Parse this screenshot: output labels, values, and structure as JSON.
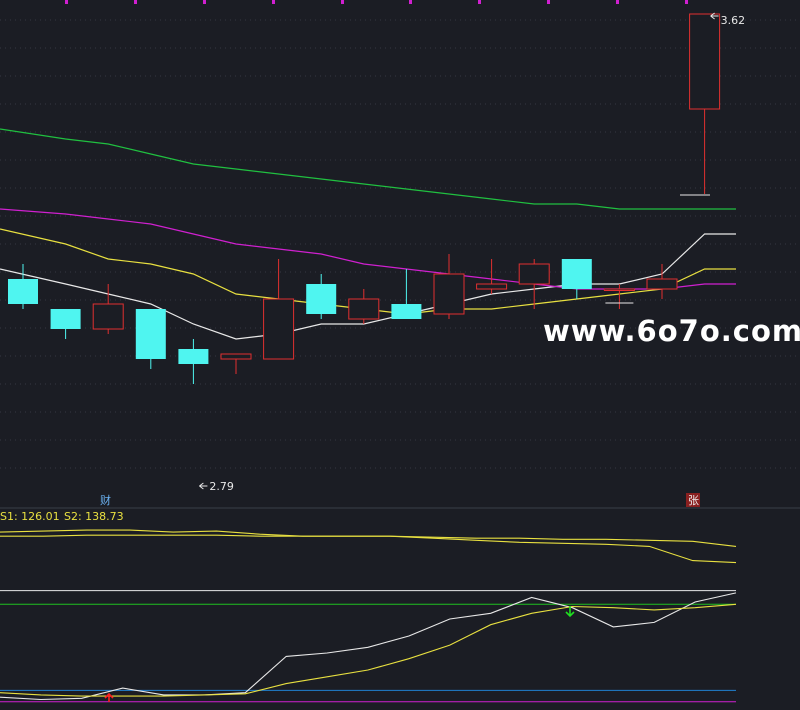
{
  "colors": {
    "background": "#1b1d24",
    "grid": "#4a4f5c",
    "up": "#e03030",
    "down": "#4ff5f0",
    "ma_white": "#e8e8e8",
    "ma_yellow": "#e8e040",
    "ma_magenta": "#d020d0",
    "ma_green": "#20c040",
    "ind_white": "#e8e8e8",
    "ind_yellow": "#e8e040",
    "ind_green_line": "#20c020",
    "ind_blue_line": "#2080d0",
    "ind_magenta_line": "#d020d0",
    "arrow_up": "#ff2020",
    "arrow_down": "#20e020",
    "marker_tag_bg": "#8a2020",
    "marker_tag_text": "#f0f0f0",
    "marker_cai": "#6ab0f0"
  },
  "watermark": {
    "text": "www.6o7o.com"
  },
  "chart_data": {
    "type": "candlestick",
    "price_axis": {
      "min": 2.7,
      "max": 3.64
    },
    "candles": [
      {
        "open": 3.09,
        "close": 3.04,
        "high": 3.12,
        "low": 3.03
      },
      {
        "open": 3.03,
        "close": 2.99,
        "high": 3.03,
        "low": 2.97
      },
      {
        "open": 2.99,
        "close": 3.04,
        "high": 3.08,
        "low": 2.98
      },
      {
        "open": 3.03,
        "close": 2.93,
        "high": 3.03,
        "low": 2.91
      },
      {
        "open": 2.95,
        "close": 2.92,
        "high": 2.97,
        "low": 2.88
      },
      {
        "open": 2.93,
        "close": 2.94,
        "high": 2.94,
        "low": 2.9
      },
      {
        "open": 2.93,
        "close": 3.05,
        "high": 3.13,
        "low": 2.93
      },
      {
        "open": 3.08,
        "close": 3.02,
        "high": 3.1,
        "low": 3.01
      },
      {
        "open": 3.01,
        "close": 3.05,
        "high": 3.07,
        "low": 3.0
      },
      {
        "open": 3.04,
        "close": 3.01,
        "high": 3.11,
        "low": 3.01
      },
      {
        "open": 3.02,
        "close": 3.1,
        "high": 3.14,
        "low": 3.01
      },
      {
        "open": 3.07,
        "close": 3.08,
        "high": 3.13,
        "low": 3.06
      },
      {
        "open": 3.08,
        "close": 3.12,
        "high": 3.13,
        "low": 3.03
      },
      {
        "open": 3.13,
        "close": 3.07,
        "high": 3.13,
        "low": 3.05
      },
      {
        "open": 3.07,
        "close": 3.07,
        "high": 3.08,
        "low": 3.03
      },
      {
        "open": 3.07,
        "close": 3.09,
        "high": 3.12,
        "low": 3.05
      },
      {
        "open": 3.43,
        "close": 3.62,
        "high": 3.62,
        "low": 3.26
      }
    ],
    "ma_series": [
      {
        "color_key": "ma_white",
        "values": [
          3.11,
          3.08,
          3.06,
          3.04,
          3.0,
          2.97,
          2.98,
          3.0,
          3.0,
          3.02,
          3.04,
          3.06,
          3.07,
          3.08,
          3.08,
          3.1,
          3.18
        ]
      },
      {
        "color_key": "ma_yellow",
        "values": [
          3.19,
          3.16,
          3.13,
          3.12,
          3.1,
          3.06,
          3.05,
          3.04,
          3.03,
          3.02,
          3.03,
          3.03,
          3.04,
          3.05,
          3.06,
          3.07,
          3.11
        ]
      },
      {
        "color_key": "ma_magenta",
        "values": [
          3.23,
          3.22,
          3.21,
          3.2,
          3.18,
          3.16,
          3.15,
          3.14,
          3.12,
          3.11,
          3.1,
          3.09,
          3.08,
          3.07,
          3.07,
          3.07,
          3.08
        ]
      },
      {
        "color_key": "ma_green",
        "values": [
          3.39,
          3.37,
          3.36,
          3.34,
          3.32,
          3.31,
          3.3,
          3.29,
          3.28,
          3.27,
          3.26,
          3.25,
          3.24,
          3.24,
          3.23,
          3.23,
          3.23
        ]
      }
    ],
    "high_label": "3.62",
    "low_label": "2.79",
    "markers": {
      "cai": "财",
      "zhang": "张"
    },
    "indicator1": {
      "label_s1": "S1: 126.01",
      "label_s2": "S2: 138.73",
      "range": [
        115,
        145
      ],
      "s1": [
        141,
        141.5,
        142,
        142,
        141,
        141.5,
        140,
        139,
        139,
        139,
        138,
        137,
        136,
        135.5,
        135,
        134,
        127,
        126
      ],
      "s2": [
        139,
        139,
        139.5,
        139.5,
        139.5,
        139.5,
        139,
        139,
        139,
        139,
        138.5,
        138,
        138,
        137.5,
        137.5,
        137,
        136.5,
        134
      ]
    },
    "indicator2": {
      "range": [
        0,
        105
      ],
      "white": [
        6,
        4,
        5,
        14,
        8,
        8,
        10,
        42,
        45,
        50,
        60,
        75,
        80,
        94,
        85,
        68,
        72,
        90,
        98
      ],
      "yellow": [
        10,
        8,
        7,
        7,
        7,
        8,
        9,
        18,
        24,
        30,
        40,
        52,
        70,
        80,
        86,
        85,
        83,
        85,
        88
      ],
      "levels": [
        {
          "value": 100,
          "color_key": "ind_white"
        },
        {
          "value": 88,
          "color_key": "ind_green_line"
        },
        {
          "value": 12,
          "color_key": "ind_blue_line"
        },
        {
          "value": 2,
          "color_key": "ind_magenta_line"
        }
      ]
    }
  }
}
